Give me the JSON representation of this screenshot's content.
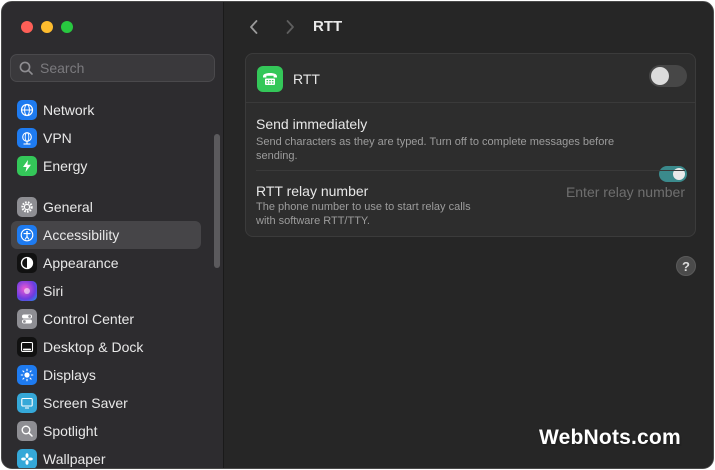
{
  "window": {
    "title": "RTT"
  },
  "search": {
    "placeholder": "Search"
  },
  "sidebar": {
    "items": [
      {
        "label": "Network",
        "icon": "globe-icon",
        "color": "#1e7bf0",
        "selected": false
      },
      {
        "label": "VPN",
        "icon": "globe-network-icon",
        "color": "#1e7bf0",
        "selected": false
      },
      {
        "label": "Energy",
        "icon": "bolt-icon",
        "color": "#34c759",
        "selected": false
      },
      {
        "label": "General",
        "icon": "gear-icon",
        "color": "#8e8e93",
        "selected": false
      },
      {
        "label": "Accessibility",
        "icon": "accessibility-icon",
        "color": "#1e7bf0",
        "selected": true
      },
      {
        "label": "Appearance",
        "icon": "appearance-icon",
        "color": "#111111",
        "selected": false
      },
      {
        "label": "Siri",
        "icon": "siri-icon",
        "color": "#a34de0",
        "selected": false
      },
      {
        "label": "Control Center",
        "icon": "control-center-icon",
        "color": "#8e8e93",
        "selected": false
      },
      {
        "label": "Desktop & Dock",
        "icon": "dock-icon",
        "color": "#111111",
        "selected": false
      },
      {
        "label": "Displays",
        "icon": "sun-icon",
        "color": "#1e7bf0",
        "selected": false
      },
      {
        "label": "Screen Saver",
        "icon": "screen-saver-icon",
        "color": "#35a8d8",
        "selected": false
      },
      {
        "label": "Spotlight",
        "icon": "magnifier-icon",
        "color": "#8e8e93",
        "selected": false
      },
      {
        "label": "Wallpaper",
        "icon": "flower-icon",
        "color": "#35a8d8",
        "selected": false
      }
    ]
  },
  "rtt": {
    "label": "RTT",
    "enabled": false,
    "icon_color": "#34c759"
  },
  "send_immediately": {
    "title": "Send immediately",
    "description": "Send characters as they are typed. Turn off to complete messages before sending.",
    "enabled": true
  },
  "relay": {
    "title": "RTT relay number",
    "description": "The phone number to use to start relay calls with software RTT/TTY.",
    "placeholder": "Enter relay number",
    "value": ""
  },
  "help": {
    "label": "?"
  },
  "watermark": {
    "text": "WebNots.com"
  },
  "colors": {
    "accent": "#3b8a8c",
    "window_bg": "#262626",
    "sidebar_bg": "#2d2c2f"
  }
}
